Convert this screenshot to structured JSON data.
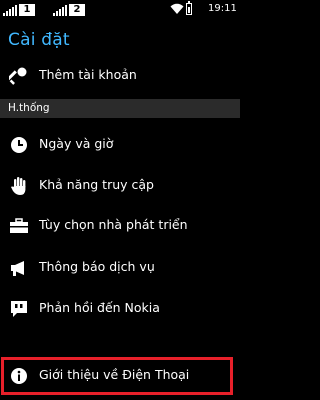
{
  "status_bar": {
    "sim1_label": "1",
    "sim2_label": "2",
    "time": "19:11",
    "icons": [
      "signal-icon",
      "signal-icon",
      "wifi-icon",
      "battery-icon"
    ]
  },
  "header": {
    "title": "Cài đặt"
  },
  "settings": {
    "account": {
      "label": "Thêm tài khoản",
      "icon": "key-icon"
    },
    "section_label": "H.thống",
    "items": [
      {
        "label": "Ngày và giờ",
        "icon": "clock-icon"
      },
      {
        "label": "Khả năng truy cập",
        "icon": "hand-icon"
      },
      {
        "label": "Tùy chọn nhà phát triển",
        "icon": "toolbox-icon"
      },
      {
        "label": "Thông báo dịch vụ",
        "icon": "megaphone-icon"
      },
      {
        "label": "Phản hồi đến Nokia",
        "icon": "quote-bubble-icon"
      },
      {
        "label": "Giới thiệu về Điện Thoại",
        "icon": "info-icon"
      }
    ]
  },
  "colors": {
    "accent": "#41b8ff",
    "highlight": "#e8202a",
    "section_bg": "#2b2b2b"
  }
}
